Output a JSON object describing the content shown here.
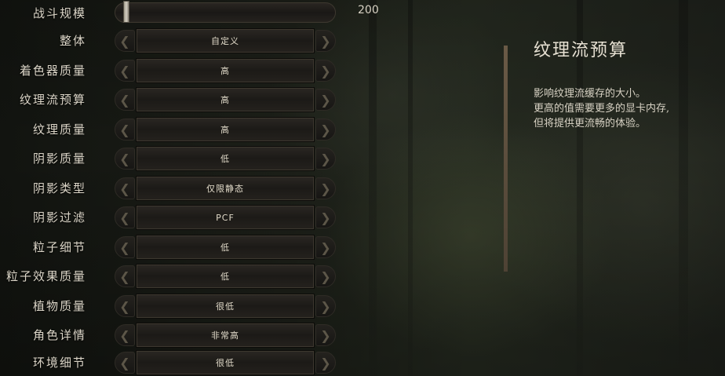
{
  "settings": {
    "battle_size": {
      "label": "战斗规模",
      "value": "200",
      "level": 0.0
    },
    "rows": [
      {
        "label": "整体",
        "value": "自定义"
      },
      {
        "label": "着色器质量",
        "value": "高"
      },
      {
        "label": "纹理流预算",
        "value": "高"
      },
      {
        "label": "纹理质量",
        "value": "高"
      },
      {
        "label": "阴影质量",
        "value": "低"
      },
      {
        "label": "阴影类型",
        "value": "仅限静态"
      },
      {
        "label": "阴影过滤",
        "value": "PCF"
      },
      {
        "label": "粒子细节",
        "value": "低"
      },
      {
        "label": "粒子效果质量",
        "value": "低"
      },
      {
        "label": "植物质量",
        "value": "很低"
      },
      {
        "label": "角色详情",
        "value": "非常高"
      },
      {
        "label": "环境细节",
        "value": "很低"
      }
    ]
  },
  "description": {
    "title": "纹理流预算",
    "lines": [
      "影响纹理流缓存的大小。",
      "更高的值需要更多的显卡内存,",
      "但将提供更流畅的体验。"
    ]
  },
  "icons": {
    "left_arrow": "chevron-left-icon",
    "right_arrow": "chevron-right-icon",
    "slider_handle": "slider-handle"
  }
}
